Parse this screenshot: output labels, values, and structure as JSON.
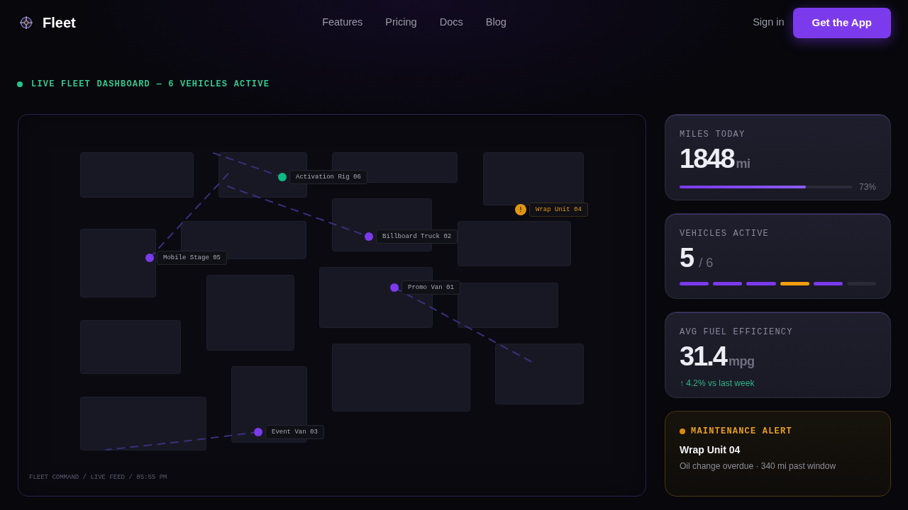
{
  "nav": {
    "brand": "Fleet",
    "links": [
      {
        "label": "Features"
      },
      {
        "label": "Pricing"
      },
      {
        "label": "Docs"
      },
      {
        "label": "Blog"
      }
    ],
    "sign_in": "Sign in",
    "cta": "Get the App"
  },
  "status_line": {
    "text": "LIVE FLEET DASHBOARD — 6 VEHICLES ACTIVE"
  },
  "map": {
    "vehicles": [
      {
        "name": "Promo Van 01",
        "color": "#7c3aed",
        "alert": false
      },
      {
        "name": "Billboard Truck 02",
        "color": "#7c3aed",
        "alert": false
      },
      {
        "name": "Event Van 03",
        "color": "#7c3aed",
        "alert": false
      },
      {
        "name": "Wrap Unit 04",
        "color": "#e0960f",
        "alert": true
      },
      {
        "name": "Mobile Stage 05",
        "color": "#7c3aed",
        "alert": false
      },
      {
        "name": "Activation Rig 06",
        "color": "#10b981",
        "alert": false
      }
    ],
    "footer": "FLEET COMMAND / LIVE FEED / 05:55 PM"
  },
  "stats": [
    {
      "kind": "progress",
      "label": "MILES TODAY",
      "value": "1848",
      "unit": "mi",
      "level": 0.73,
      "reading": "73%"
    },
    {
      "kind": "segments",
      "label": "VEHICLES ACTIVE",
      "value": "5",
      "unit": "/ 6",
      "segments": [
        {
          "color": "#7c3aed"
        },
        {
          "color": "#7c3aed"
        },
        {
          "color": "#7c3aed"
        },
        {
          "color": "#f59e0b"
        },
        {
          "color": "#7c3aed"
        },
        {
          "color": "#2a2a38"
        }
      ]
    },
    {
      "kind": "trend",
      "label": "AVG FUEL EFFICIENCY",
      "value": "31.4",
      "unit": "mpg",
      "trend": "↑ 4.2% vs last week"
    }
  ],
  "alert": {
    "title": "MAINTENANCE ALERT",
    "vehicle": "Wrap Unit 04",
    "detail": "Oil change overdue · 340 mi past window"
  }
}
